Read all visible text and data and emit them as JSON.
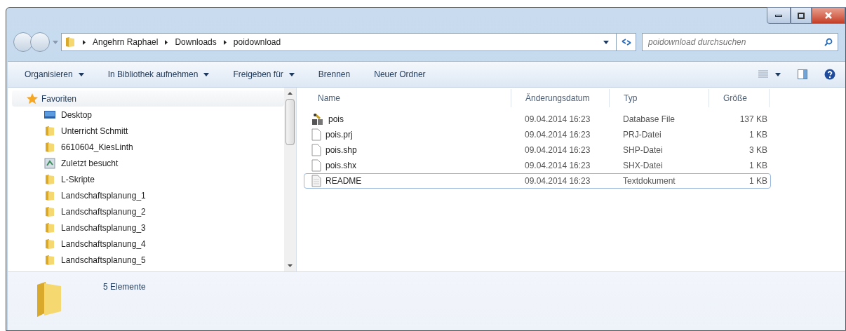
{
  "breadcrumb": [
    "Angehrn Raphael",
    "Downloads",
    "poidownload"
  ],
  "search": {
    "placeholder": "poidownload durchsuchen"
  },
  "toolbar": [
    {
      "label": "Organisieren",
      "dropdown": true
    },
    {
      "label": "In Bibliothek aufnehmen",
      "dropdown": true
    },
    {
      "label": "Freigeben für",
      "dropdown": true
    },
    {
      "label": "Brennen",
      "dropdown": false
    },
    {
      "label": "Neuer Ordner",
      "dropdown": false
    }
  ],
  "sidebar": {
    "items": [
      {
        "label": "Favoriten",
        "kind": "star",
        "children": [
          {
            "label": "Desktop",
            "kind": "desktop"
          },
          {
            "label": "Unterricht Schmitt",
            "kind": "folder"
          },
          {
            "label": "6610604_KiesLinth",
            "kind": "folder"
          },
          {
            "label": "Zuletzt besucht",
            "kind": "recent"
          },
          {
            "label": "L-Skripte",
            "kind": "folder"
          },
          {
            "label": "Landschaftsplanung_1",
            "kind": "folder"
          },
          {
            "label": "Landschaftsplanung_2",
            "kind": "folder"
          },
          {
            "label": "Landschaftsplanung_3",
            "kind": "folder"
          },
          {
            "label": "Landschaftsplanung_4",
            "kind": "folder"
          },
          {
            "label": "Landschaftsplanung_5",
            "kind": "folder"
          }
        ]
      }
    ]
  },
  "table": {
    "columns": [
      "Name",
      "Änderungsdatum",
      "Typ",
      "Größe"
    ],
    "rows": [
      {
        "kind": "database",
        "focused": false,
        "cells": [
          "pois",
          "09.04.2014 16:23",
          "Database File",
          "137 KB"
        ]
      },
      {
        "kind": "file",
        "focused": false,
        "cells": [
          "pois.prj",
          "09.04.2014 16:23",
          "PRJ-Datei",
          "1 KB"
        ]
      },
      {
        "kind": "file",
        "focused": false,
        "cells": [
          "pois.shp",
          "09.04.2014 16:23",
          "SHP-Datei",
          "3 KB"
        ]
      },
      {
        "kind": "file",
        "focused": false,
        "cells": [
          "pois.shx",
          "09.04.2014 16:23",
          "SHX-Datei",
          "1 KB"
        ]
      },
      {
        "kind": "text",
        "focused": true,
        "cells": [
          "README",
          "09.04.2014 16:23",
          "Textdokument",
          "1 KB"
        ]
      }
    ]
  },
  "status_bar": {
    "count": "5 Elemente"
  }
}
